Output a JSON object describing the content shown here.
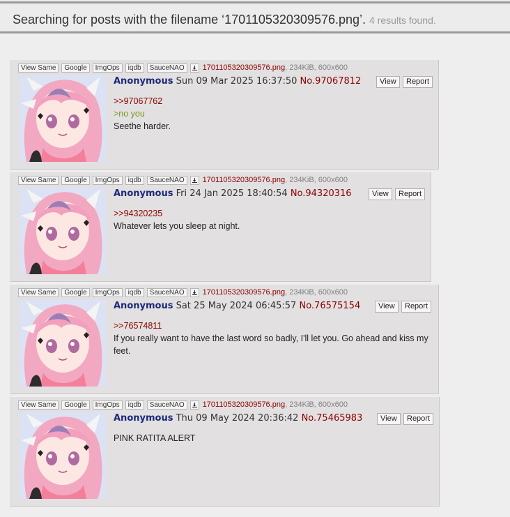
{
  "search": {
    "text_before": "Searching for posts with the filename ‘1701105320309576.png’.",
    "results": "4 results found."
  },
  "file_tags": [
    "View Same",
    "Google",
    "ImgOps",
    "iqdb",
    "SauceNAO"
  ],
  "icons": {
    "download": "download-icon"
  },
  "colors": {
    "name": "#1a2a7a",
    "post_number": "#8b0000",
    "greentext": "#789922",
    "post_bg": "#e2e0e0"
  },
  "buttons": {
    "view": "View",
    "report": "Report"
  },
  "posts": [
    {
      "filename": "1701105320309576.png",
      "file_info": ", 234KiB, 600x600",
      "name": "Anonymous",
      "date": "Sun 09 Mar 2025 16:37:50",
      "number": "No.97067812",
      "ref": ">>97067762",
      "greentext": ">no you",
      "text": "Seethe harder."
    },
    {
      "filename": "1701105320309576.png",
      "file_info": ", 234KiB, 600x600",
      "name": "Anonymous",
      "date": "Fri 24 Jan 2025 18:40:54",
      "number": "No.94320316",
      "ref": ">>94320235",
      "text": "Whatever lets you sleep at night."
    },
    {
      "filename": "1701105320309576.png",
      "file_info": ", 234KiB, 600x600",
      "name": "Anonymous",
      "date": "Sat 25 May 2024 06:45:57",
      "number": "No.76575154",
      "ref": ">>76574811",
      "text": "If you really want to have the last word so badly, I'll let you. Go ahead and kiss my feet."
    },
    {
      "filename": "1701105320309576.png",
      "file_info": ", 234KiB, 600x600",
      "name": "Anonymous",
      "date": "Thu 09 May 2024 20:36:42",
      "number": "No.75465983",
      "text": "PINK RATITA ALERT"
    }
  ]
}
